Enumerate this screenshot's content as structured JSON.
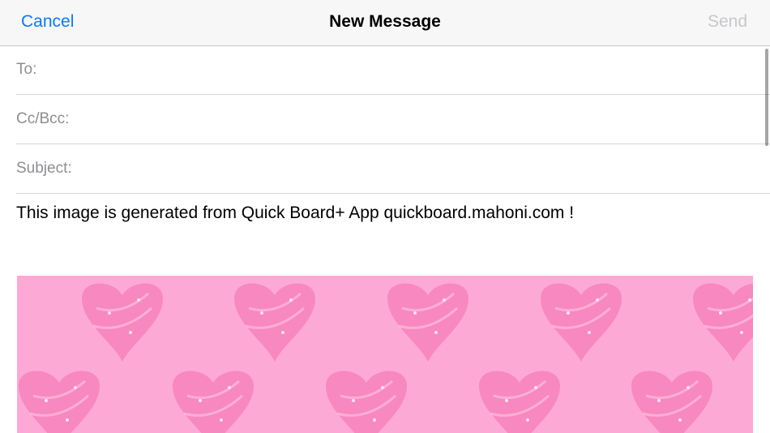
{
  "nav": {
    "cancel_label": "Cancel",
    "title": "New Message",
    "send_label": "Send"
  },
  "fields": {
    "to_label": "To:",
    "cc_label": "Cc/Bcc:",
    "subject_label": "Subject:"
  },
  "body": {
    "text": "This image is generated from Quick Board+ App quickboard.mahoni.com !"
  },
  "attachment": {
    "pattern_icon": "heart-icon",
    "background_color": "#fda9d6",
    "heart_color": "#f782bc"
  },
  "colors": {
    "accent": "#0a7aff",
    "disabled": "#c7c7cc",
    "label": "#8e8e93"
  }
}
